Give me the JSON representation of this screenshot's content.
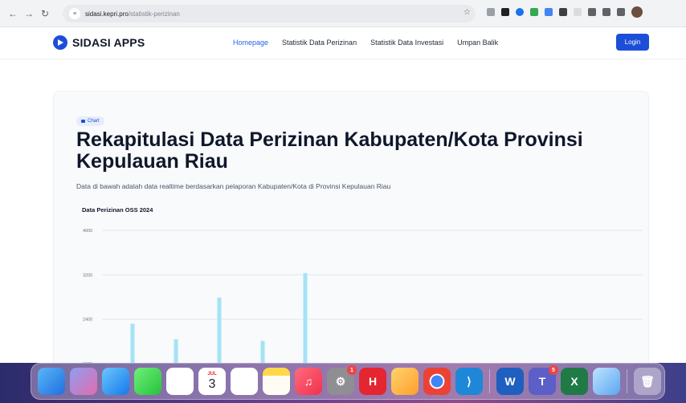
{
  "browser": {
    "url_domain": "sidasi.kepri.pro",
    "url_path": "/statistik-perizinan"
  },
  "header": {
    "brand": "SIDASI APPS",
    "menu": [
      "Homepage",
      "Statistik Data Perizinan",
      "Statistik Data Investasi",
      "Umpan Balik"
    ],
    "login": "Login"
  },
  "card": {
    "badge": "Chart",
    "title": "Rekapitulasi Data Perizinan Kabupaten/Kota Provinsi Kepulauan Riau",
    "subtitle": "Data di bawah adalah data realtime berdasarkan pelaporan Kabupaten/Kota di Provinsi Kepulauan Riau"
  },
  "chart_data": {
    "type": "bar",
    "title": "Data Perizinan OSS 2024",
    "yticks": [
      4000,
      3200,
      2400,
      1600
    ],
    "ylim": [
      0,
      4000
    ],
    "values": [
      2320,
      2040,
      2790,
      2010,
      3230
    ],
    "color": "#a5e3f5",
    "grid": true
  },
  "dock": {
    "icons": [
      "finder-icon",
      "launchpad-icon",
      "safari-icon",
      "messages-icon",
      "photos-icon",
      "calendar-icon",
      "reminders-icon",
      "notes-icon",
      "music-icon",
      "settings-icon",
      "hbo-icon",
      "migrate-icon",
      "chrome-icon",
      "vscode-icon",
      "word-icon",
      "teams-icon",
      "excel-icon",
      "preview-icon",
      "trash-icon"
    ],
    "calendar_month": "JUL",
    "calendar_day": "3",
    "settings_badge": "1",
    "teams_badge": "5"
  }
}
